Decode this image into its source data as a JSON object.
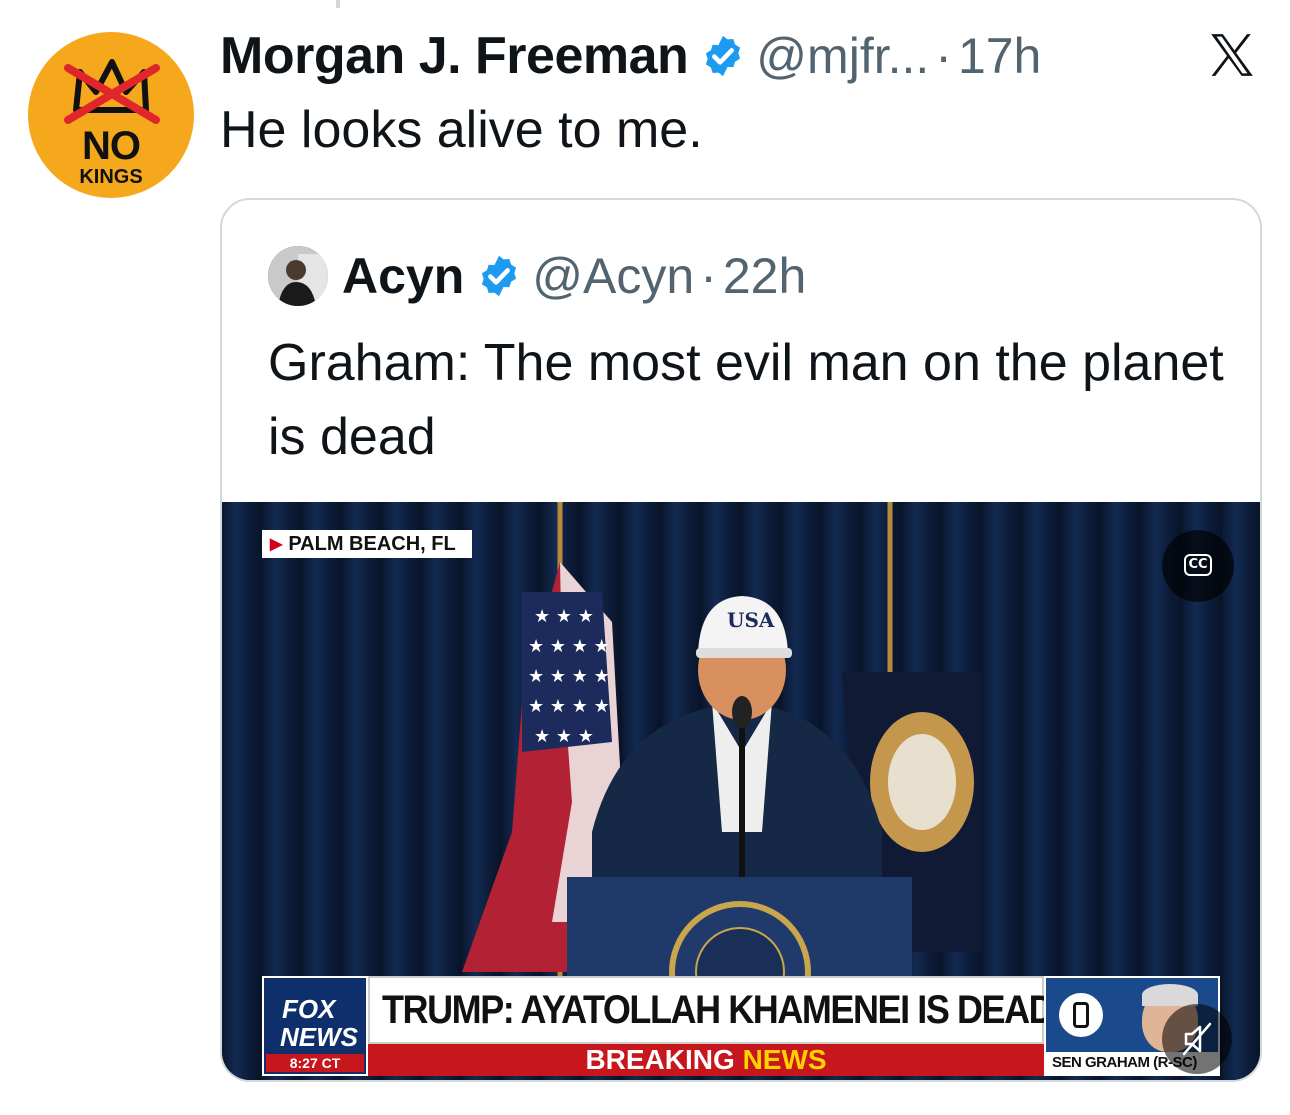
{
  "tweet": {
    "author_name": "Morgan J. Freeman",
    "author_handle": "@mjfr...",
    "separator": "·",
    "time": "17h",
    "text": "He looks alive to me.",
    "avatar": {
      "text_top": "NO",
      "text_bottom": "KINGS",
      "color": "#f5a81c"
    },
    "verified_color": "#1d9bf0"
  },
  "quoted_tweet": {
    "author_name": "Acyn",
    "author_handle": "@Acyn",
    "separator": "·",
    "time": "22h",
    "text": "Graham: The most evil man on the planet is dead"
  },
  "video": {
    "location_tag": "PALM BEACH, FL",
    "cap_text": "USA",
    "cc_label": "CC",
    "lower_third": {
      "network_line1": "FOX",
      "network_line2": "NEWS",
      "clock": "8:27 CT",
      "headline": "TRUMP: AYATOLLAH KHAMENEI IS DEAD",
      "breaking": "BREAKING",
      "news": "NEWS",
      "guest_label": "SEN GRAHAM (R-SC)"
    }
  },
  "icons": [
    "x-logo-icon",
    "verified-badge-icon",
    "cc-icon",
    "mute-icon",
    "phone-icon"
  ]
}
